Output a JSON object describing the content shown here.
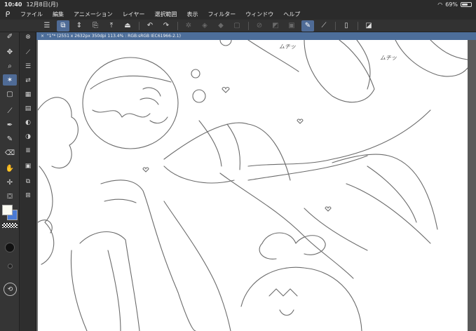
{
  "statusbar": {
    "time": "10:40",
    "date": "12月8日(月)",
    "battery": "69%",
    "battery_level": 0.69,
    "wifi_icon": "wifi-icon"
  },
  "menubar": {
    "logo_icon": "clip-studio-logo-icon",
    "items": [
      "ファイル",
      "編集",
      "アニメーション",
      "レイヤー",
      "選択範囲",
      "表示",
      "フィルター",
      "ウィンドウ",
      "ヘルプ"
    ]
  },
  "commandbar": {
    "icons": [
      "menu-icon",
      "layer-property-icon",
      "spinner-icon",
      "new-document-icon",
      "open-file-icon",
      "save-icon",
      "undo-icon",
      "redo-icon",
      "clear-icon",
      "fill-icon",
      "transform-icon",
      "crop-icon",
      "deselect-icon",
      "invert-selection-icon",
      "select-draw-icon",
      "pen-settings-icon",
      "ruler-icon",
      "smartphone-icon",
      "fit-screen-icon"
    ]
  },
  "document": {
    "tab_title": "\"1\"* (2551 x 2632px 350dpi 113.4% : RGB:sRGB IEC61966-2.1)"
  },
  "sketch_notes": {
    "note1": "ムチッ",
    "note2": "ムチッ"
  },
  "colors": {
    "main": "#fbfbf2",
    "sub": "#4a7ad4",
    "accent": "#4f6b96",
    "tab": "#4d6e9a"
  }
}
